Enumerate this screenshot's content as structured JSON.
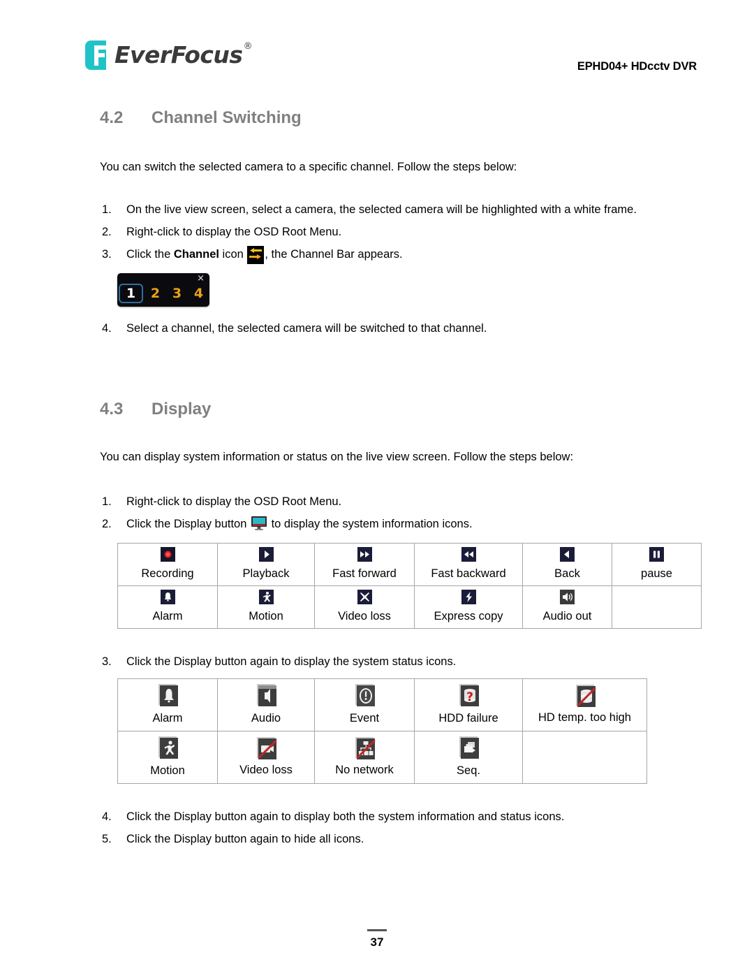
{
  "header": {
    "logo_text": "EverFocus",
    "logo_reg": "®",
    "model": "EPHD04+  HDcctv DVR"
  },
  "section_channel": {
    "number": "4.2",
    "title": "Channel Switching",
    "intro": "You can switch the selected camera to a specific channel. Follow the steps below:",
    "steps": [
      {
        "marker": "1.",
        "text": "On the live view screen, select a camera, the selected camera will be highlighted with a white frame."
      },
      {
        "marker": "2.",
        "text": "Right-click to display the OSD Root Menu."
      },
      {
        "marker": "3.",
        "text_before": "Click the ",
        "bold_word": "Channel",
        "text_mid": " icon ",
        "icon": "channel-switch-icon",
        "text_after": ", the Channel Bar appears."
      },
      {
        "marker": "4.",
        "text": "Select a channel, the selected camera will be switched to that channel."
      }
    ],
    "channel_bar": {
      "close_label": "×",
      "channels": [
        "1",
        "2",
        "3",
        "4"
      ],
      "selected": "1",
      "selected_border_color": "#2f6f9f",
      "number_color": "#e8a317",
      "background_color": "#0b0b0f"
    }
  },
  "section_display": {
    "number": "4.3",
    "title": "Display",
    "intro": "You can display system information or status on the live view screen. Follow the steps below:",
    "steps": [
      {
        "marker": "1.",
        "text": "Right-click to display the OSD Root Menu."
      },
      {
        "marker": "2.",
        "text_before": "Click the Display button ",
        "icon": "display-monitor-icon",
        "text_after": " to display the system information icons."
      },
      {
        "marker": "3.",
        "text": "Click the Display button again to display the system status icons."
      },
      {
        "marker": "4.",
        "text": "Click the Display button again to display both the system information and status icons."
      },
      {
        "marker": "5.",
        "text": "Click the Display button again to hide all icons."
      }
    ],
    "info_icons_table": {
      "rows": [
        [
          {
            "icon": "recording-icon",
            "label": "Recording"
          },
          {
            "icon": "playback-icon",
            "label": "Playback"
          },
          {
            "icon": "fast-forward-icon",
            "label": "Fast forward"
          },
          {
            "icon": "fast-backward-icon",
            "label": "Fast backward"
          },
          {
            "icon": "back-icon",
            "label": "Back"
          },
          {
            "icon": "pause-icon",
            "label": "pause"
          }
        ],
        [
          {
            "icon": "alarm-bell-icon",
            "label": "Alarm"
          },
          {
            "icon": "motion-person-icon",
            "label": "Motion"
          },
          {
            "icon": "video-loss-x-icon",
            "label": "Video loss"
          },
          {
            "icon": "express-copy-icon",
            "label": "Express copy"
          },
          {
            "icon": "audio-out-icon",
            "label": "Audio out"
          },
          {
            "icon": "",
            "label": ""
          }
        ]
      ]
    },
    "status_icons_table": {
      "rows": [
        [
          {
            "icon": "status-alarm-icon",
            "label": "Alarm"
          },
          {
            "icon": "status-audio-icon",
            "label": "Audio"
          },
          {
            "icon": "status-event-icon",
            "label": "Event"
          },
          {
            "icon": "status-hdd-failure-icon",
            "label": "HDD failure"
          },
          {
            "icon": "status-hd-temp-icon",
            "label": "HD temp. too high"
          }
        ],
        [
          {
            "icon": "status-motion-icon",
            "label": "Motion"
          },
          {
            "icon": "status-video-loss-icon",
            "label": "Video loss"
          },
          {
            "icon": "status-no-network-icon",
            "label": "No network"
          },
          {
            "icon": "status-seq-icon",
            "label": "Seq."
          },
          {
            "icon": "",
            "label": ""
          }
        ]
      ]
    }
  },
  "footer": {
    "page_number": "37"
  },
  "colors": {
    "heading_gray": "#808080",
    "logo_teal": "#21c3c8",
    "error_red": "#c02626",
    "icon_navy": "#1a1c38"
  }
}
